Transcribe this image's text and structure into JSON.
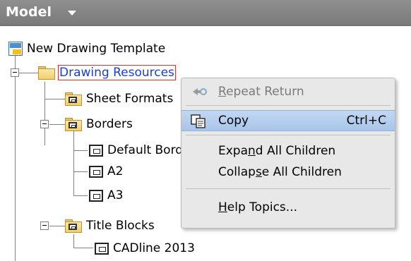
{
  "header": {
    "title": "Model",
    "caret_icon": "chevron-down-icon"
  },
  "tree": {
    "root_label": "New Drawing Template",
    "resources_label": "Drawing Resources",
    "sheet_formats_label": "Sheet Formats",
    "borders_label": "Borders",
    "default_border_label": "Default Border",
    "a2_label": "A2",
    "a3_label": "A3",
    "title_blocks_label": "Title Blocks",
    "cadline_label": "CADline 2013"
  },
  "context_menu": {
    "repeat_pre": "",
    "repeat_u": "R",
    "repeat_post": "epeat Return",
    "copy_label": "Copy",
    "copy_shortcut": "Ctrl+C",
    "expand_pre": "Expa",
    "expand_u": "n",
    "expand_post": "d All Children",
    "collapse_pre": "Collap",
    "collapse_u": "s",
    "collapse_post": "e All Children",
    "help_pre": "",
    "help_u": "H",
    "help_post": "elp Topics..."
  },
  "colors": {
    "header_bg": "#808080",
    "selection_border": "#e0302a",
    "selection_text": "#1a3fd0",
    "menu_hover": "#b6cff0"
  }
}
